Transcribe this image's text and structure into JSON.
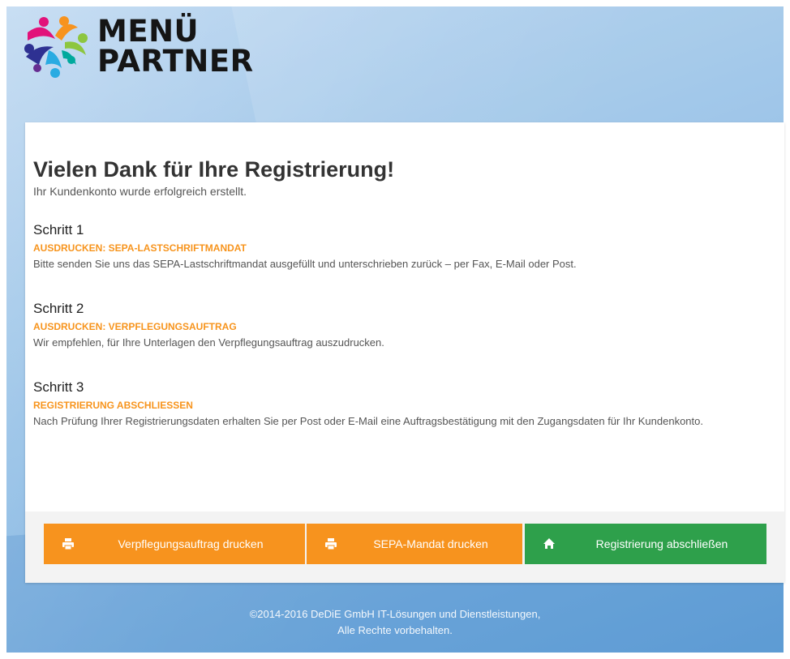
{
  "brand": {
    "line1": "MENÜ",
    "line2": "PARTNER"
  },
  "header": {
    "title": "Vielen Dank für Ihre Registrierung!",
    "subtitle": "Ihr Kundenkonto wurde erfolgreich erstellt."
  },
  "steps": [
    {
      "title": "Schritt 1",
      "action": "AUSDRUCKEN: SEPA-LASTSCHRIFTMANDAT",
      "description": "Bitte senden Sie uns das SEPA-Lastschriftmandat ausgefüllt und unterschrieben zurück – per Fax, E-Mail oder Post."
    },
    {
      "title": "Schritt 2",
      "action": "AUSDRUCKEN: VERPFLEGUNGSAUFTRAG",
      "description": "Wir empfehlen, für Ihre Unterlagen den Verpflegungsauftrag auszudrucken."
    },
    {
      "title": "Schritt 3",
      "action": "REGISTRIERUNG ABSCHLIESSEN",
      "description": "Nach Prüfung Ihrer Registrierungsdaten erhalten Sie per Post oder E-Mail eine Auftragsbestätigung mit den Zugangsdaten für Ihr Kundenkonto."
    }
  ],
  "buttons": {
    "print_order": {
      "label": "Verpflegungsauftrag drucken",
      "icon": "printer-icon"
    },
    "print_sepa": {
      "label": "SEPA-Mandat drucken",
      "icon": "printer-icon"
    },
    "finish": {
      "label": "Registrierung abschließen",
      "icon": "home-icon"
    }
  },
  "footer": {
    "line1": "©2014-2016 DeDiE GmbH IT-Lösungen und Dienstleistungen,",
    "line2": "Alle Rechte vorbehalten."
  },
  "colors": {
    "accent_orange": "#f7931e",
    "accent_green": "#2ea04b",
    "background_blue": "#8fbde5"
  }
}
